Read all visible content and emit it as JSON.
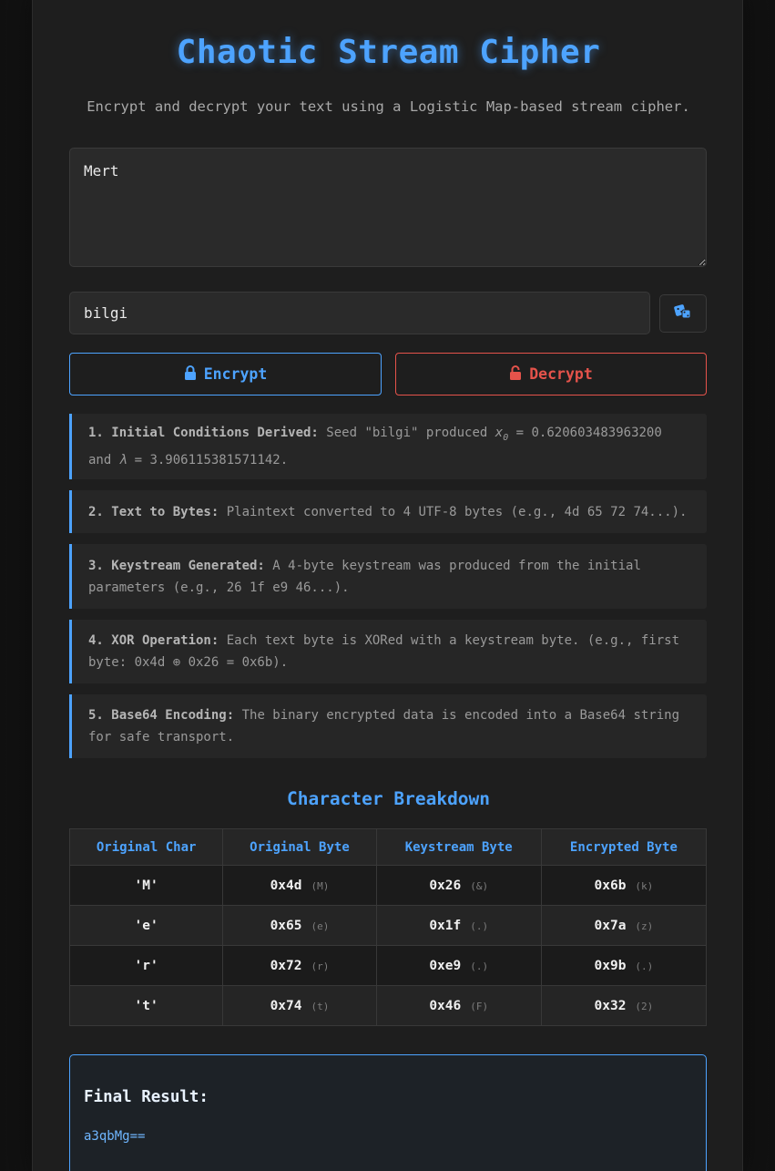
{
  "header": {
    "title": "Chaotic Stream Cipher",
    "subtitle": "Encrypt and decrypt your text using a Logistic Map-based stream cipher."
  },
  "input": {
    "text_value": "Mert",
    "seed_value": "bilgi",
    "dice_icon": "dice-icon"
  },
  "buttons": {
    "encrypt_label": "Encrypt",
    "encrypt_icon": "lock-icon",
    "decrypt_label": "Decrypt",
    "decrypt_icon": "unlock-icon"
  },
  "steps": [
    {
      "heading": "1. Initial Conditions Derived:",
      "text_a": " Seed \"bilgi\" produced ",
      "var_x": "x",
      "var_x_sub": "0",
      "text_b": " = 0.620603483963200 and ",
      "var_lambda": "λ",
      "text_c": " = 3.906115381571142."
    },
    {
      "heading": "2. Text to Bytes:",
      "text": " Plaintext converted to 4 UTF-8 bytes (e.g., 4d 65 72 74...)."
    },
    {
      "heading": "3. Keystream Generated:",
      "text": " A 4-byte keystream was produced from the initial parameters (e.g., 26 1f e9 46...)."
    },
    {
      "heading": "4. XOR Operation:",
      "text": " Each text byte is XORed with a keystream byte. (e.g., first byte: 0x4d ⊕ 0x26 = 0x6b)."
    },
    {
      "heading": "5. Base64 Encoding:",
      "text": " The binary encrypted data is encoded into a Base64 string for safe transport."
    }
  ],
  "breakdown": {
    "title": "Character Breakdown",
    "headers": [
      "Original Char",
      "Original Byte",
      "Keystream Byte",
      "Encrypted Byte"
    ],
    "rows": [
      {
        "char": "'M'",
        "orig": "0x4d",
        "orig_hint": "(M)",
        "key": "0x26",
        "key_hint": "(&)",
        "enc": "0x6b",
        "enc_hint": "(k)"
      },
      {
        "char": "'e'",
        "orig": "0x65",
        "orig_hint": "(e)",
        "key": "0x1f",
        "key_hint": "(.)",
        "enc": "0x7a",
        "enc_hint": "(z)"
      },
      {
        "char": "'r'",
        "orig": "0x72",
        "orig_hint": "(r)",
        "key": "0xe9",
        "key_hint": "(.)",
        "enc": "0x9b",
        "enc_hint": "(.)"
      },
      {
        "char": "'t'",
        "orig": "0x74",
        "orig_hint": "(t)",
        "key": "0x46",
        "key_hint": "(F)",
        "enc": "0x32",
        "enc_hint": "(2)"
      }
    ]
  },
  "result": {
    "label": "Final Result:",
    "value": "a3qbMg=="
  },
  "colors": {
    "accent": "#4da3ff",
    "danger": "#e5534b",
    "background": "#1e1e1e"
  }
}
